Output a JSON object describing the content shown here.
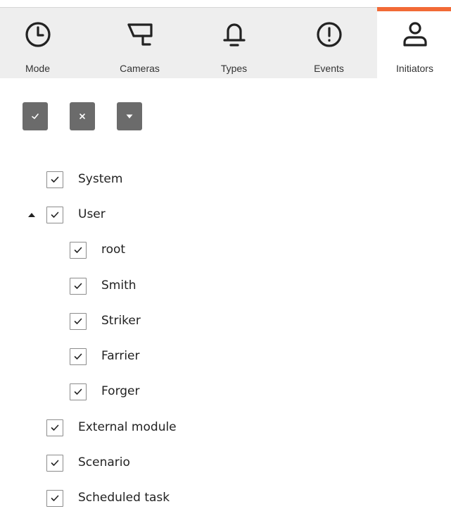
{
  "tabs": [
    {
      "label": "Mode",
      "icon": "clock-icon",
      "active": false
    },
    {
      "label": "Cameras",
      "icon": "camera-icon",
      "active": false
    },
    {
      "label": "Types",
      "icon": "bell-icon",
      "active": false
    },
    {
      "label": "Events",
      "icon": "alert-circle-icon",
      "active": false
    },
    {
      "label": "Initiators",
      "icon": "user-icon",
      "active": true
    }
  ],
  "accent_color": "#f26a36",
  "toolbar": {
    "check_all_icon": "check-icon",
    "uncheck_all_icon": "close-icon",
    "dropdown_icon": "caret-down-icon"
  },
  "tree": [
    {
      "label": "System",
      "checked": true,
      "level": 0
    },
    {
      "label": "User",
      "checked": true,
      "level": 0,
      "expanded": true
    },
    {
      "label": "root",
      "checked": true,
      "level": 1
    },
    {
      "label": "Smith",
      "checked": true,
      "level": 1
    },
    {
      "label": "Striker",
      "checked": true,
      "level": 1
    },
    {
      "label": "Farrier",
      "checked": true,
      "level": 1
    },
    {
      "label": "Forger",
      "checked": true,
      "level": 1
    },
    {
      "label": "External module",
      "checked": true,
      "level": 0
    },
    {
      "label": "Scenario",
      "checked": true,
      "level": 0
    },
    {
      "label": "Scheduled task",
      "checked": true,
      "level": 0
    }
  ]
}
